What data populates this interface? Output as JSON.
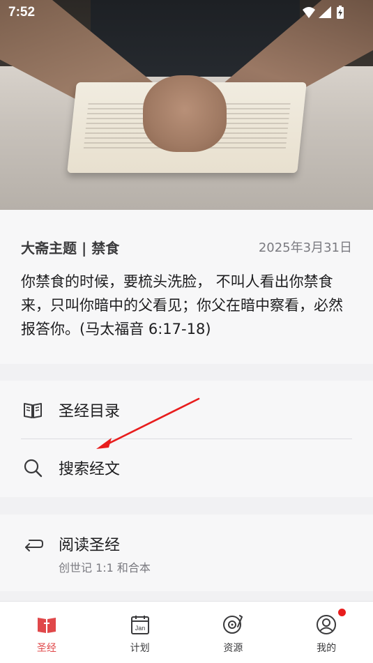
{
  "status_bar": {
    "time": "7:52",
    "icons": [
      "wifi-icon",
      "signal-icon",
      "battery-charging-icon"
    ]
  },
  "hero": {
    "image": "hands-praying-on-bible-photo"
  },
  "devotion": {
    "title": "大斋主题 | 禁食",
    "date": "2025年3月31日",
    "verse": "你禁食的时候，要梳头洗脸， 不叫人看出你禁食来，只叫你暗中的父看见；你父在暗中察看，必然报答你。(马太福音 6:17-18)"
  },
  "menu": {
    "bible_catalog": {
      "label": "圣经目录",
      "icon": "book-open-icon"
    },
    "search_scripture": {
      "label": "搜索经文",
      "icon": "search-icon"
    }
  },
  "reading": {
    "label": "阅读圣经",
    "subtitle": "创世记 1:1 和合本",
    "icon": "return-arrow-icon"
  },
  "bottom_nav": {
    "items": [
      {
        "label": "圣经",
        "icon": "bible-icon",
        "active": true
      },
      {
        "label": "计划",
        "icon": "calendar-jan-icon",
        "active": false
      },
      {
        "label": "资源",
        "icon": "record-player-icon",
        "active": false
      },
      {
        "label": "我的",
        "icon": "profile-icon",
        "active": false,
        "badge": true
      }
    ],
    "calendar_text": "Jan"
  },
  "colors": {
    "accent": "#e0484a",
    "annotation_arrow": "#e81d1d",
    "background": "#f1f1f3",
    "card": "#f7f7f8"
  }
}
